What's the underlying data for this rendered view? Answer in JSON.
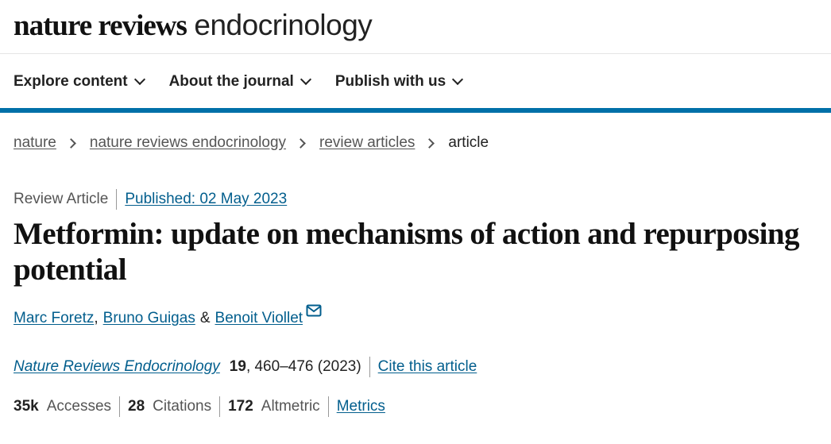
{
  "header": {
    "brand_bold": "nature reviews",
    "brand_light": "endocrinology"
  },
  "nav": {
    "items": [
      {
        "label": "Explore content"
      },
      {
        "label": "About the journal"
      },
      {
        "label": "Publish with us"
      }
    ]
  },
  "breadcrumb": {
    "items": [
      "nature",
      "nature reviews endocrinology",
      "review articles"
    ],
    "current": "article"
  },
  "article": {
    "type": "Review Article",
    "published": "Published: 02 May 2023",
    "title": "Metformin: update on mechanisms of action and repurposing potential",
    "authors": [
      "Marc Foretz",
      "Bruno Guigas",
      "Benoit Viollet"
    ],
    "comma": ",",
    "amp": "&",
    "journal": "Nature Reviews Endocrinology",
    "volume": "19",
    "pages_year": ", 460–476 (2023)",
    "cite_label": "Cite this article"
  },
  "metrics": {
    "accesses_value": "35k",
    "accesses_label": "Accesses",
    "citations_value": "28",
    "citations_label": "Citations",
    "altmetric_value": "172",
    "altmetric_label": "Altmetric",
    "metrics_link": "Metrics"
  },
  "colors": {
    "accent": "#0070a8",
    "link": "#025e8d"
  },
  "icons": {
    "mail": "envelope-icon",
    "chevron": "chevron-down-icon"
  }
}
